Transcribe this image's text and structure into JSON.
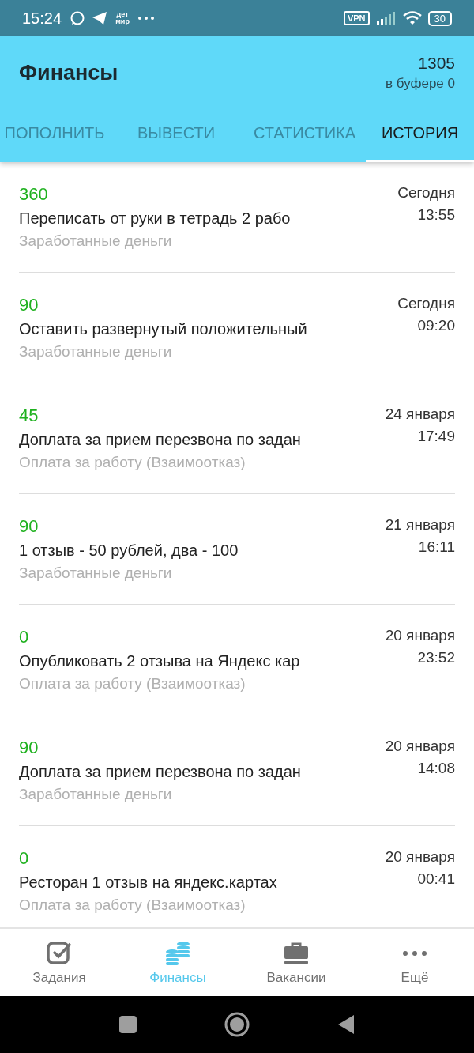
{
  "status_bar": {
    "time": "15:24",
    "app_badge": "дет мир",
    "vpn": "VPN",
    "battery": "30"
  },
  "header": {
    "title": "Финансы",
    "balance": "1305",
    "buffer": "в буфере 0"
  },
  "tabs": [
    {
      "label": "ПОПОЛНИТЬ",
      "selected": false
    },
    {
      "label": "ВЫВЕСТИ",
      "selected": false
    },
    {
      "label": "СТАТИСТИКА",
      "selected": false
    },
    {
      "label": "ИСТОРИЯ",
      "selected": true
    }
  ],
  "history": [
    {
      "amount": "360",
      "title": "Переписать от руки в тетрадь 2 рабо",
      "type": "Заработанные деньги",
      "date": "Сегодня",
      "time": "13:55"
    },
    {
      "amount": "90",
      "title": "Оставить развернутый положительный",
      "type": "Заработанные деньги",
      "date": "Сегодня",
      "time": "09:20"
    },
    {
      "amount": "45",
      "title": "Доплата за прием перезвона по задан",
      "type": "Оплата за работу (Взаимоотказ)",
      "date": "24 января",
      "time": "17:49"
    },
    {
      "amount": "90",
      "title": "1 отзыв - 50 рублей, два - 100",
      "type": "Заработанные деньги",
      "date": "21 января",
      "time": "16:11"
    },
    {
      "amount": "0",
      "title": "Опубликовать 2 отзыва на Яндекс кар",
      "type": "Оплата за работу (Взаимоотказ)",
      "date": "20 января",
      "time": "23:52"
    },
    {
      "amount": "90",
      "title": "Доплата за прием перезвона по задан",
      "type": "Заработанные деньги",
      "date": "20 января",
      "time": "14:08"
    },
    {
      "amount": "0",
      "title": "Ресторан 1 отзыв на яндекс.картах",
      "type": "Оплата за работу (Взаимоотказ)",
      "date": "20 января",
      "time": "00:41"
    }
  ],
  "bottom_nav": [
    {
      "kind": "tasks",
      "label": "Задания",
      "selected": false
    },
    {
      "kind": "finance",
      "label": "Финансы",
      "selected": true
    },
    {
      "kind": "jobs",
      "label": "Вакансии",
      "selected": false
    },
    {
      "kind": "more",
      "label": "Ещё",
      "selected": false
    }
  ]
}
